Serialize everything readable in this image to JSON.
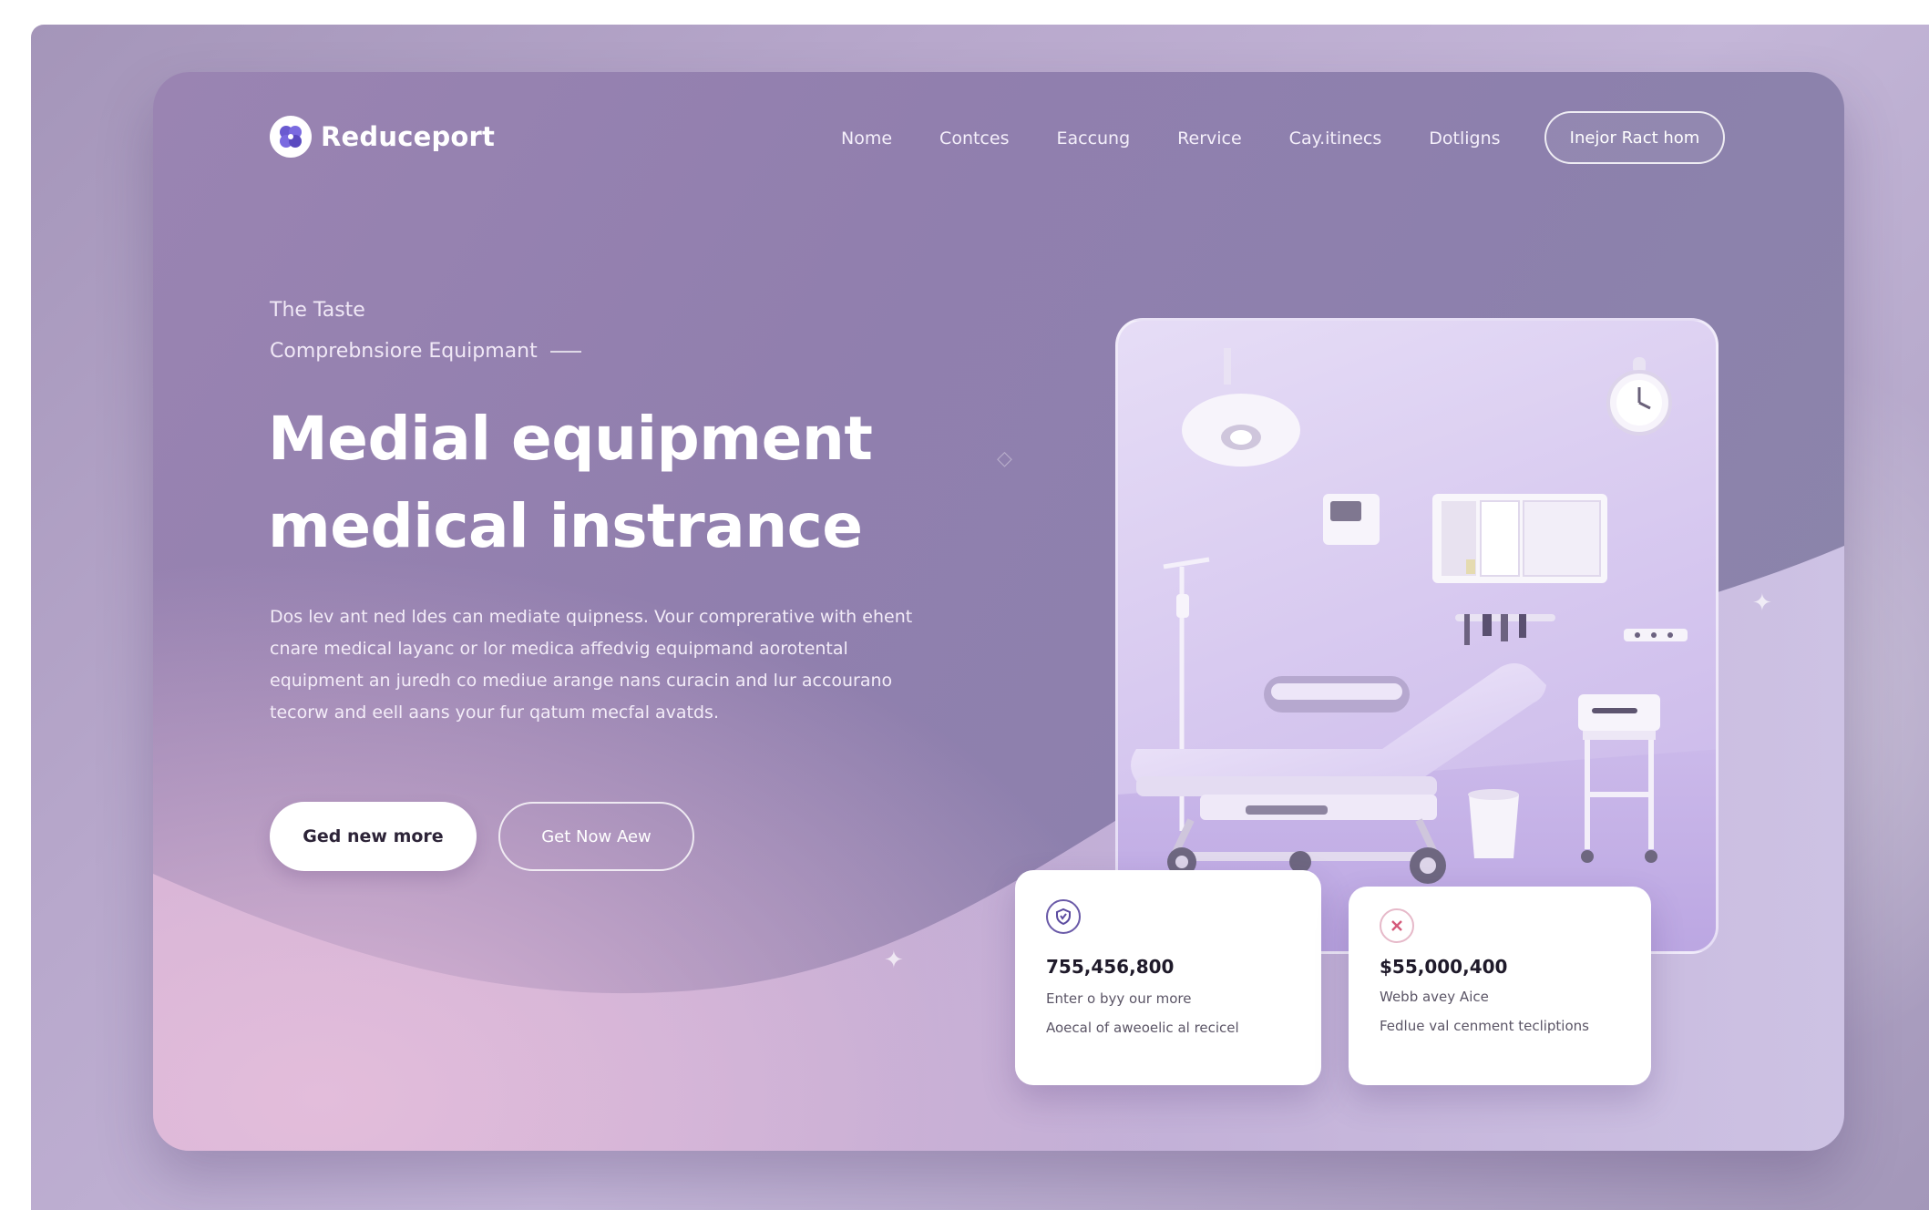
{
  "brand": {
    "name": "Reduceport",
    "logo_icon": "flower-logo-icon"
  },
  "nav": {
    "items": [
      "Nome",
      "Contces",
      "Eaccung",
      "Rervice",
      "Cay.itinecs",
      "Dotligns"
    ],
    "cta_label": "Inejor Ract hom"
  },
  "hero": {
    "eyebrow_1": "The Taste",
    "eyebrow_2": "Comprebnsiore Equipmant",
    "headline_line_1": "Medial equipment",
    "headline_line_2": "medical instrance",
    "description_lines": [
      "Dos lev ant ned ldes can mediate quipness. Vour comprerative with ehent",
      "cnare medical layanc or lor medica affedvig equipmand aorotental",
      "equipment an juredh co mediue arange nans curacin and lur accourano",
      "tecorw and eell aans your fur qatum mecfal avatds."
    ],
    "primary_button": "Ged new more",
    "secondary_button": "Get Now Aew"
  },
  "stats": [
    {
      "icon": "shield-icon",
      "value": "755,456,800",
      "line_1": "Enter o byy our more",
      "line_2": "Aoecal of aweoelic al recicel"
    },
    {
      "icon": "cross-icon",
      "value": "$55,000,400",
      "line_1": "Webb avey Aice",
      "line_2": "Fedlue val cenment tecliptions"
    }
  ],
  "colors": {
    "accent": "#6a5aa8",
    "card_bg": "#917fae",
    "panel_bg": "#d8caf0"
  }
}
